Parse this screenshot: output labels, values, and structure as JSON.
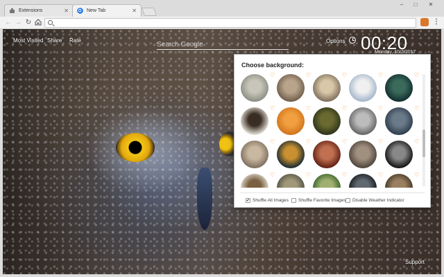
{
  "browser": {
    "tabs": [
      {
        "label": "Extensions",
        "active": false
      },
      {
        "label": "New Tab",
        "active": true
      }
    ],
    "omnibox": {
      "value": "",
      "placeholder": ""
    },
    "window_controls": [
      "–",
      "□",
      "✕"
    ]
  },
  "page": {
    "nav": {
      "most_visited": "Most Visited",
      "share": "Share",
      "rate": "Rate"
    },
    "search": {
      "placeholder": "Search Google"
    },
    "options_label": "Options",
    "clock": {
      "time": "00:20",
      "date": "Monday, 10/2/2017"
    },
    "support_label": "Support"
  },
  "panel": {
    "title": "Choose background:",
    "thumbnails": [
      {
        "colors": [
          "#8a8a80",
          "#c8c6bb"
        ],
        "favorite": false
      },
      {
        "colors": [
          "#6b5a48",
          "#b8a48a"
        ],
        "favorite": false
      },
      {
        "colors": [
          "#7a6a58",
          "#d8c8a8"
        ],
        "favorite": false
      },
      {
        "colors": [
          "#9eb2c8",
          "#f0f0f0"
        ],
        "favorite": false
      },
      {
        "colors": [
          "#0f2a2e",
          "#3a6a5a"
        ],
        "favorite": false
      },
      {
        "colors": [
          "#f0ece2",
          "#3a2e24"
        ],
        "favorite": false
      },
      {
        "colors": [
          "#d07018",
          "#f0a040"
        ],
        "favorite": false
      },
      {
        "colors": [
          "#2a3018",
          "#6a6a30"
        ],
        "favorite": false
      },
      {
        "colors": [
          "#606060",
          "#bcbcbc"
        ],
        "favorite": false
      },
      {
        "colors": [
          "#2a3a4a",
          "#6a7a88"
        ],
        "favorite": false
      },
      {
        "colors": [
          "#7a6a5a",
          "#c8b8a0"
        ],
        "favorite": false
      },
      {
        "colors": [
          "#0e2430",
          "#c89030"
        ],
        "favorite": false
      },
      {
        "colors": [
          "#5a1a10",
          "#c07050"
        ],
        "favorite": false
      },
      {
        "colors": [
          "#4a4038",
          "#a09080"
        ],
        "favorite": false
      },
      {
        "colors": [
          "#0a0a0a",
          "#888888"
        ],
        "favorite": false
      },
      {
        "colors": [
          "#e8e8e0",
          "#7a6040"
        ],
        "favorite": false
      },
      {
        "colors": [
          "#4a4a40",
          "#a09878"
        ],
        "favorite": false
      },
      {
        "colors": [
          "#2a5a20",
          "#a0b070"
        ],
        "favorite": false
      },
      {
        "colors": [
          "#101418",
          "#606870"
        ],
        "favorite": false
      },
      {
        "colors": [
          "#3a3020",
          "#9a8060"
        ],
        "favorite": false
      }
    ],
    "options": [
      {
        "label": "Shuffle All Images",
        "checked": true
      },
      {
        "label": "Shuffle Favorite Images",
        "checked": false
      },
      {
        "label": "Disable Weather Indicator",
        "checked": false
      }
    ]
  },
  "colors": {
    "heart": "#f08a2a",
    "panel_bg": "#ffffff",
    "accent": "#1a73e8"
  }
}
